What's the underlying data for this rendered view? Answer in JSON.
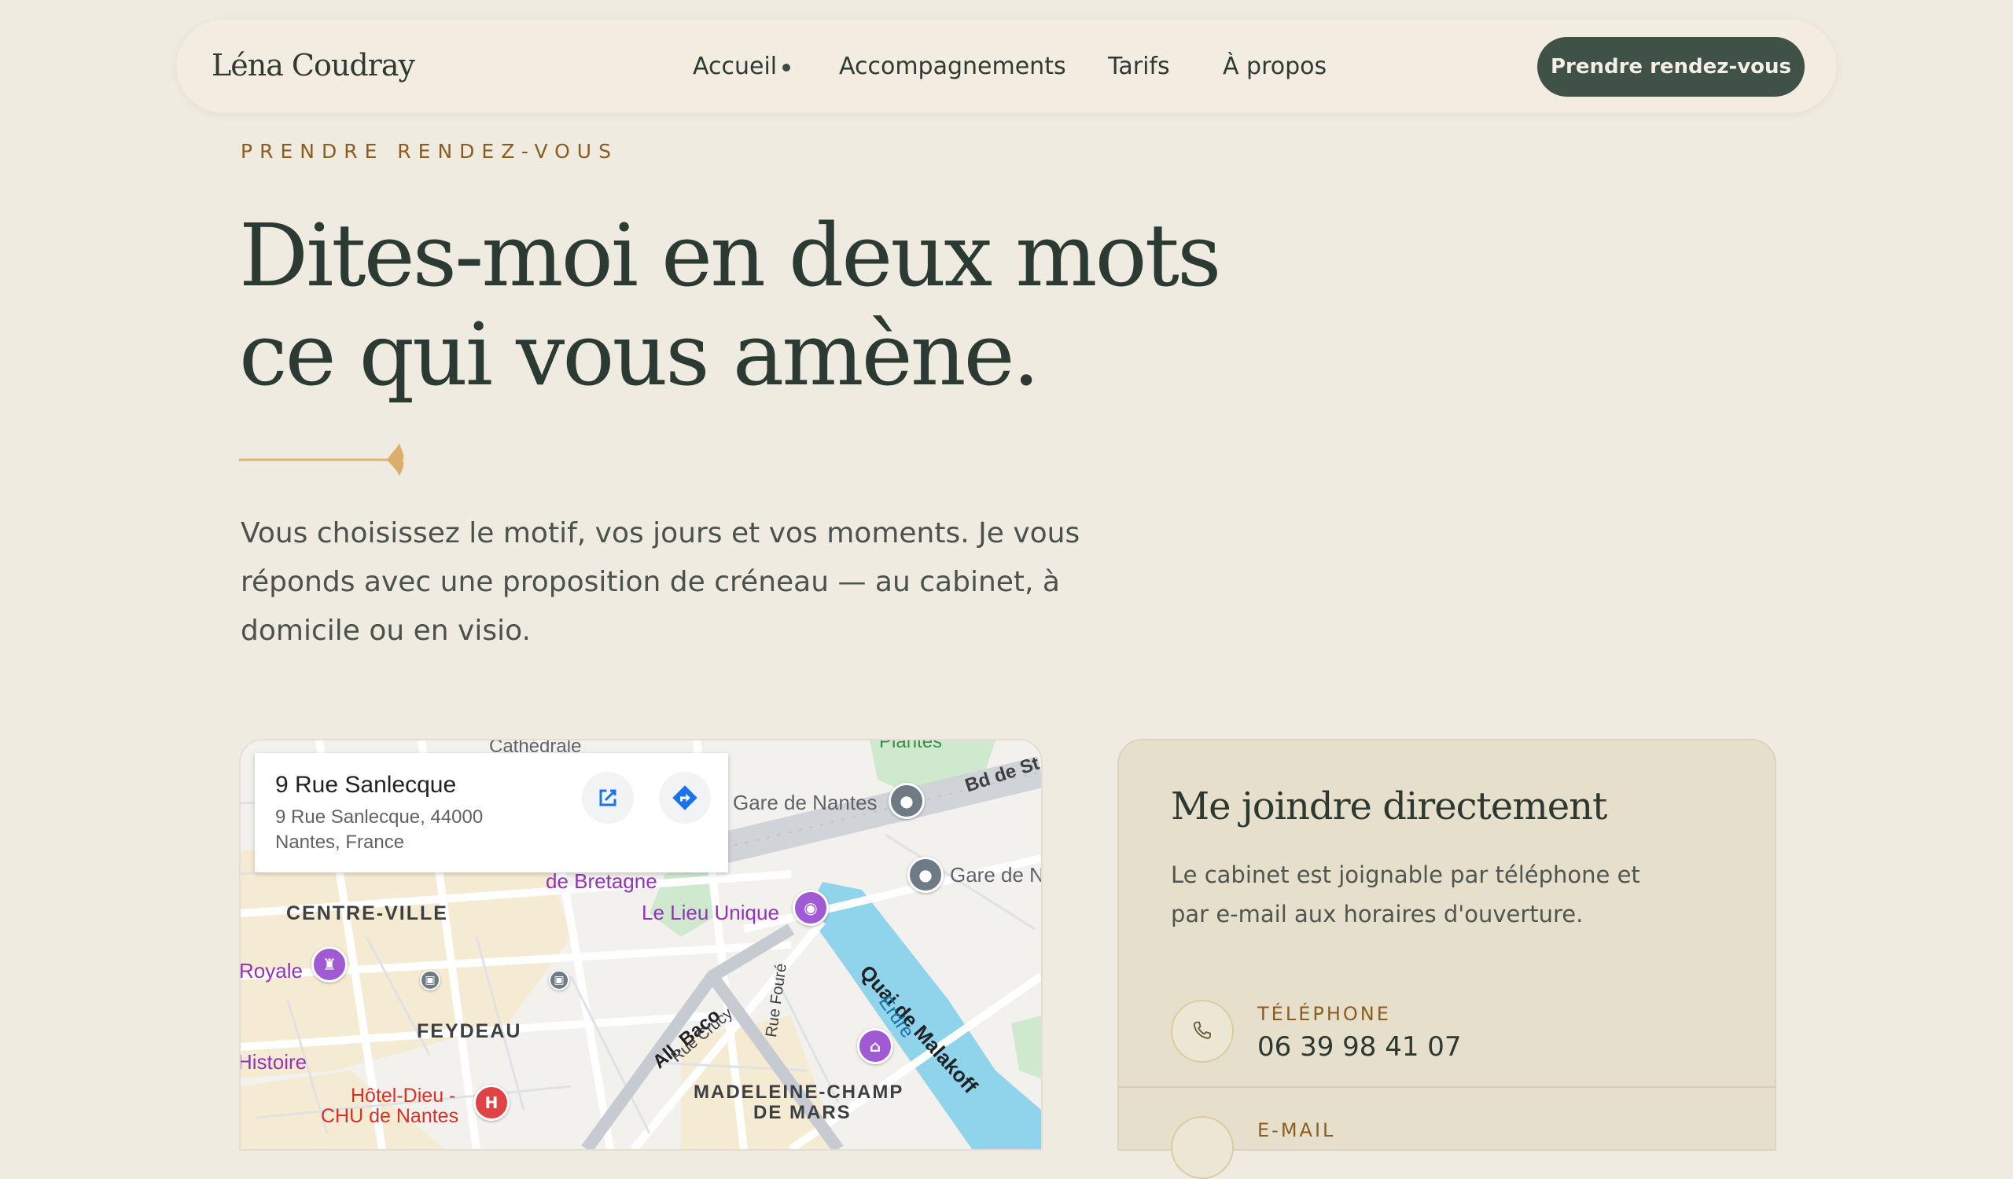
{
  "nav": {
    "brand": "Léna Coudray",
    "links": [
      "Accueil",
      "Accompagnements",
      "Tarifs",
      "À propos"
    ],
    "cta": "Prendre rendez-vous"
  },
  "hero": {
    "eyebrow": "PRENDRE RENDEZ-VOUS",
    "title_line1": "Dites-moi en deux mots",
    "title_line2": "ce qui vous amène.",
    "lede": "Vous choisissez le motif, vos jours et vos moments. Je vous réponds avec une proposition de créneau — au cabinet, à domicile ou en visio."
  },
  "map": {
    "place_title": "9 Rue Sanlecque",
    "address_line1": "9 Rue Sanlecque, 44000",
    "address_line2": "Nantes, France",
    "labels": {
      "cathedrale": "Cathédrale",
      "plantes": "Plantes",
      "gare1": "Gare de Nantes",
      "gare2": "Gare de N",
      "bd": "Bd de St",
      "bretagne": "de Bretagne",
      "lieu_unique": "Le Lieu Unique",
      "centre": "CENTRE-VILLE",
      "royale": "Royale",
      "feydeau": "FEYDEAU",
      "histoire": "Histoire",
      "hotel_dieu1": "Hôtel-Dieu -",
      "hotel_dieu2": "CHU de Nantes",
      "malakoff": "Quai de Malakoff",
      "erdre": "Erdre",
      "baco": "All. Baco",
      "crucy": "Rue Crucy",
      "foure": "Rue Fouré",
      "madeleine1": "MADELEINE-CHAMP",
      "madeleine2": "DE MARS",
      "hospital_letter": "H"
    }
  },
  "contact": {
    "title": "Me joindre directement",
    "description": "Le cabinet est joignable par téléphone et par e-mail aux horaires d'ouverture.",
    "phone_label": "TÉLÉPHONE",
    "phone_value": "06 39 98 41 07",
    "email_label": "E-MAIL"
  },
  "colors": {
    "background": "#efebe0",
    "accent_dark_green": "#405247",
    "eyebrow_gold": "#8a5d1f",
    "card_bg": "#e6dfcc"
  }
}
